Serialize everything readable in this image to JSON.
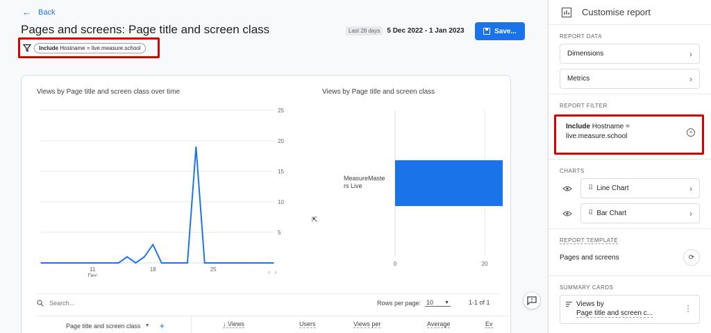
{
  "header": {
    "back_label": "Back",
    "page_title": "Pages and screens: Page title and screen class",
    "date_chip": "Last 28 days",
    "date_range": "5 Dec 2022 - 1 Jan 2023",
    "save_label": "Save..."
  },
  "filter_chip": {
    "include": "Include",
    "condition": "Hostname = live.measure.school"
  },
  "line_chart": {
    "title": "Views by Page title and screen class over time"
  },
  "bar_chart": {
    "title": "Views by Page title and screen class"
  },
  "chart_data": [
    {
      "type": "line",
      "title": "Views by Page title and screen class over time",
      "x_tick_labels": [
        "11\nDec",
        "18",
        "25"
      ],
      "x": [
        "5 Dec",
        "6 Dec",
        "7 Dec",
        "8 Dec",
        "9 Dec",
        "10 Dec",
        "11 Dec",
        "12 Dec",
        "13 Dec",
        "14 Dec",
        "15 Dec",
        "16 Dec",
        "17 Dec",
        "18 Dec",
        "19 Dec",
        "20 Dec",
        "21 Dec",
        "22 Dec",
        "23 Dec",
        "24 Dec",
        "25 Dec",
        "26 Dec",
        "27 Dec",
        "28 Dec",
        "29 Dec",
        "30 Dec",
        "31 Dec",
        "1 Jan"
      ],
      "values": [
        0,
        0,
        0,
        0,
        0,
        0,
        0,
        0,
        0,
        0,
        1,
        0,
        1,
        3,
        0,
        0,
        0,
        0,
        19,
        0,
        0,
        0,
        0,
        0,
        0,
        0,
        0,
        0
      ],
      "yticks": [
        5,
        10,
        15,
        20,
        25
      ],
      "ylim": [
        0,
        25
      ],
      "color": "#1a73e8"
    },
    {
      "type": "bar",
      "title": "Views by Page title and screen class",
      "categories": [
        "MeasureMasters Live"
      ],
      "category_lines": [
        "MeasureMaste",
        "rs Live"
      ],
      "values": [
        24
      ],
      "xticks": [
        0,
        20
      ],
      "xlim": [
        0,
        24
      ],
      "color": "#1a73e8"
    }
  ],
  "table": {
    "search_placeholder": "Search...",
    "rows_per_page_label": "Rows per page:",
    "rows_per_page_value": "10",
    "pager_count": "1-1 of 1",
    "dimension_header": "Page title and screen class",
    "col_views": "↓ Views",
    "col_users": "Users",
    "col_views_per": "Views per",
    "col_average": "Average",
    "col_ev": "Ev"
  },
  "panel": {
    "title": "Customise report",
    "report_data_label": "REPORT DATA",
    "dimensions_label": "Dimensions",
    "metrics_label": "Metrics",
    "report_filter_label": "REPORT FILTER",
    "filter_include": "Include",
    "filter_line1": "Hostname =",
    "filter_line2": "live.measure.school",
    "charts_label": "CHARTS",
    "line_chart_label": "Line Chart",
    "bar_chart_label": "Bar Chart",
    "report_template_label": "REPORT TEMPLATE",
    "template_value": "Pages and screens",
    "summary_cards_label": "SUMMARY CARDS",
    "summary_line1": "Views by",
    "summary_line2": "Page title and screen c..."
  }
}
